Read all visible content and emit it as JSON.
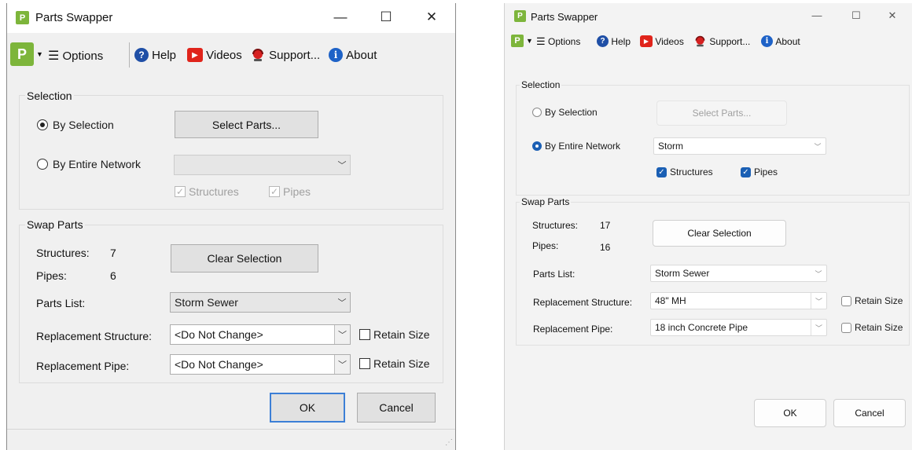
{
  "left_window": {
    "title": "Parts Swapper",
    "app_icon_glyph": "P",
    "caption_buttons": {
      "minimize": "—",
      "maximize": "☐",
      "close": "✕"
    },
    "toolbar": {
      "options_label": "Options",
      "help_label": "Help",
      "videos_label": "Videos",
      "support_label": "Support...",
      "about_label": "About"
    },
    "selection_group": {
      "label": "Selection",
      "by_selection_label": "By Selection",
      "by_selection_checked": true,
      "by_entire_network_label": "By Entire Network",
      "by_entire_network_checked": false,
      "select_parts_button": "Select Parts...",
      "network_value": "",
      "structures_label": "Structures",
      "structures_checked": true,
      "pipes_label": "Pipes",
      "pipes_checked": true
    },
    "swap_group": {
      "label": "Swap Parts",
      "structures_label": "Structures:",
      "structures_count": "7",
      "pipes_label": "Pipes:",
      "pipes_count": "6",
      "clear_selection_button": "Clear Selection",
      "parts_list_label": "Parts List:",
      "parts_list_value": "Storm Sewer",
      "replacement_structure_label": "Replacement Structure:",
      "replacement_structure_value": "<Do Not Change>",
      "replacement_pipe_label": "Replacement Pipe:",
      "replacement_pipe_value": "<Do Not Change>",
      "retain_size_label": "Retain Size"
    },
    "ok_button": "OK",
    "cancel_button": "Cancel"
  },
  "right_window": {
    "title": "Parts Swapper",
    "app_icon_glyph": "P",
    "caption_buttons": {
      "minimize": "—",
      "maximize": "☐",
      "close": "✕"
    },
    "toolbar": {
      "options_label": "Options",
      "help_label": "Help",
      "videos_label": "Videos",
      "support_label": "Support...",
      "about_label": "About"
    },
    "selection_group": {
      "label": "Selection",
      "by_selection_label": "By Selection",
      "by_selection_checked": false,
      "by_entire_network_label": "By Entire Network",
      "by_entire_network_checked": true,
      "select_parts_button": "Select Parts...",
      "network_value": "Storm",
      "structures_label": "Structures",
      "structures_checked": true,
      "pipes_label": "Pipes",
      "pipes_checked": true
    },
    "swap_group": {
      "label": "Swap Parts",
      "structures_label": "Structures:",
      "structures_count": "17",
      "pipes_label": "Pipes:",
      "pipes_count": "16",
      "clear_selection_button": "Clear Selection",
      "parts_list_label": "Parts List:",
      "parts_list_value": "Storm Sewer",
      "replacement_structure_label": "Replacement Structure:",
      "replacement_structure_value": "48\" MH",
      "replacement_pipe_label": "Replacement Pipe:",
      "replacement_pipe_value": "18 inch Concrete Pipe",
      "retain_size_label": "Retain Size"
    },
    "ok_button": "OK",
    "cancel_button": "Cancel"
  },
  "colors": {
    "brand_green": "#7db53b",
    "accent_blue": "#1a5fb4",
    "default_button_border": "#3c7fd6",
    "video_red": "#e0241b"
  }
}
